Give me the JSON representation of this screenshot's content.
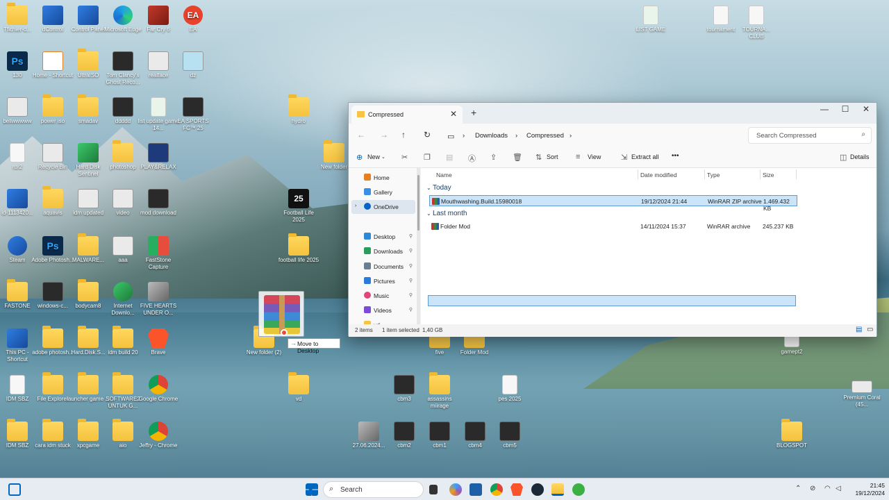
{
  "desktop": {
    "icons": [
      {
        "label": "Tfichier-d..."
      },
      {
        "label": "dControl"
      },
      {
        "label": "Control Panel"
      },
      {
        "label": "Microsoft Edge"
      },
      {
        "label": "Far Cry 6"
      },
      {
        "label": "EA"
      },
      {
        "label": "130"
      },
      {
        "label": "Home - Shortcut"
      },
      {
        "label": "UltraISO"
      },
      {
        "label": "Tom Clancy's Ghost Reco..."
      },
      {
        "label": "realface"
      },
      {
        "label": "dz"
      },
      {
        "label": "bellwwwww"
      },
      {
        "label": "power iso"
      },
      {
        "label": "smadav"
      },
      {
        "label": "ddddd"
      },
      {
        "label": "list update game 14..."
      },
      {
        "label": "EA SPORTS FC™ 25"
      },
      {
        "label": "rdr2"
      },
      {
        "label": "Recycle Bin"
      },
      {
        "label": "Hard Disk Sentinel"
      },
      {
        "label": "photoshop"
      },
      {
        "label": "PLAY&RELAX"
      },
      {
        "label": "id-1113420..."
      },
      {
        "label": "aquavis"
      },
      {
        "label": "idm updated"
      },
      {
        "label": "video"
      },
      {
        "label": "mod download"
      },
      {
        "label": "Steam"
      },
      {
        "label": "Adobe Photosh..."
      },
      {
        "label": "MALWARE..."
      },
      {
        "label": "aaa"
      },
      {
        "label": "FastStone Capture"
      },
      {
        "label": "FASTONE"
      },
      {
        "label": "windows-c..."
      },
      {
        "label": "bodycam8"
      },
      {
        "label": "Internet Downlo..."
      },
      {
        "label": "FIVE HEARTS UNDER O..."
      },
      {
        "label": "This PC - Shortcut"
      },
      {
        "label": "adobe photosh..."
      },
      {
        "label": "Hard.Disk.S..."
      },
      {
        "label": "idm build 20"
      },
      {
        "label": "Brave"
      },
      {
        "label": "IDM SBZ"
      },
      {
        "label": "File Explorer"
      },
      {
        "label": "launcher game ..."
      },
      {
        "label": "SOFTWARE2 UNTUK G..."
      },
      {
        "label": "Google Chrome"
      },
      {
        "label": "IDM SBZ"
      },
      {
        "label": "cara idm stuck"
      },
      {
        "label": "xpcgame"
      },
      {
        "label": "aio"
      },
      {
        "label": "Jeffry - Chrome"
      },
      {
        "label": "hydro"
      },
      {
        "label": "New folder"
      },
      {
        "label": "Football Life 2025"
      },
      {
        "label": "football life 2025"
      },
      {
        "label": "New folder (2)"
      },
      {
        "label": "vd"
      },
      {
        "label": "five"
      },
      {
        "label": "Folder Mod"
      },
      {
        "label": "cbm3"
      },
      {
        "label": "assassins miirage"
      },
      {
        "label": "pes 2025"
      },
      {
        "label": "27.06.2024..."
      },
      {
        "label": "cbm2"
      },
      {
        "label": "cbm1"
      },
      {
        "label": "cbm4"
      },
      {
        "label": "cbm5"
      },
      {
        "label": "LIST GAME"
      },
      {
        "label": "tournament"
      },
      {
        "label": "TOURNA... CLUB"
      },
      {
        "label": "gamept2"
      },
      {
        "label": "Premium Coral (45..."
      },
      {
        "label": "BLOGSPOT"
      }
    ]
  },
  "drag": {
    "tooltip": "Move to Desktop"
  },
  "explorer": {
    "tab_title": "Compressed",
    "new_tab": "+",
    "breadcrumb": [
      "Downloads",
      "Compressed"
    ],
    "search_placeholder": "Search Compressed",
    "toolbar": {
      "new": "New",
      "sort": "Sort",
      "view": "View",
      "extract_all": "Extract all",
      "more": "•••",
      "details": "Details"
    },
    "nav": [
      {
        "label": "Home"
      },
      {
        "label": "Gallery"
      },
      {
        "label": "OneDrive"
      },
      {
        "label": "Desktop"
      },
      {
        "label": "Downloads"
      },
      {
        "label": "Documents"
      },
      {
        "label": "Pictures"
      },
      {
        "label": "Music"
      },
      {
        "label": "Videos"
      },
      {
        "label": "vd"
      }
    ],
    "columns": [
      "Name",
      "Date modified",
      "Type",
      "Size"
    ],
    "groups": [
      {
        "label": "Today",
        "files": [
          {
            "name": "Mouthwashing.Build.15980018",
            "date": "19/12/2024 21:44",
            "type": "WinRAR ZIP archive",
            "size": "1.469.432 KB"
          }
        ]
      },
      {
        "label": "Last month",
        "files": [
          {
            "name": "Folder Mod",
            "date": "14/11/2024 15:37",
            "type": "WinRAR archive",
            "size": "245.237 KB"
          }
        ]
      }
    ],
    "status": {
      "items": "2 items",
      "selected": "1 item selected",
      "size": "1,40 GB"
    }
  },
  "taskbar": {
    "search": "Search",
    "time": "21:45",
    "date": "19/12/2024"
  },
  "colors": {
    "accent": "#0067c0",
    "selection": "#cce4f7",
    "taskbar": "#e6ecf1"
  }
}
